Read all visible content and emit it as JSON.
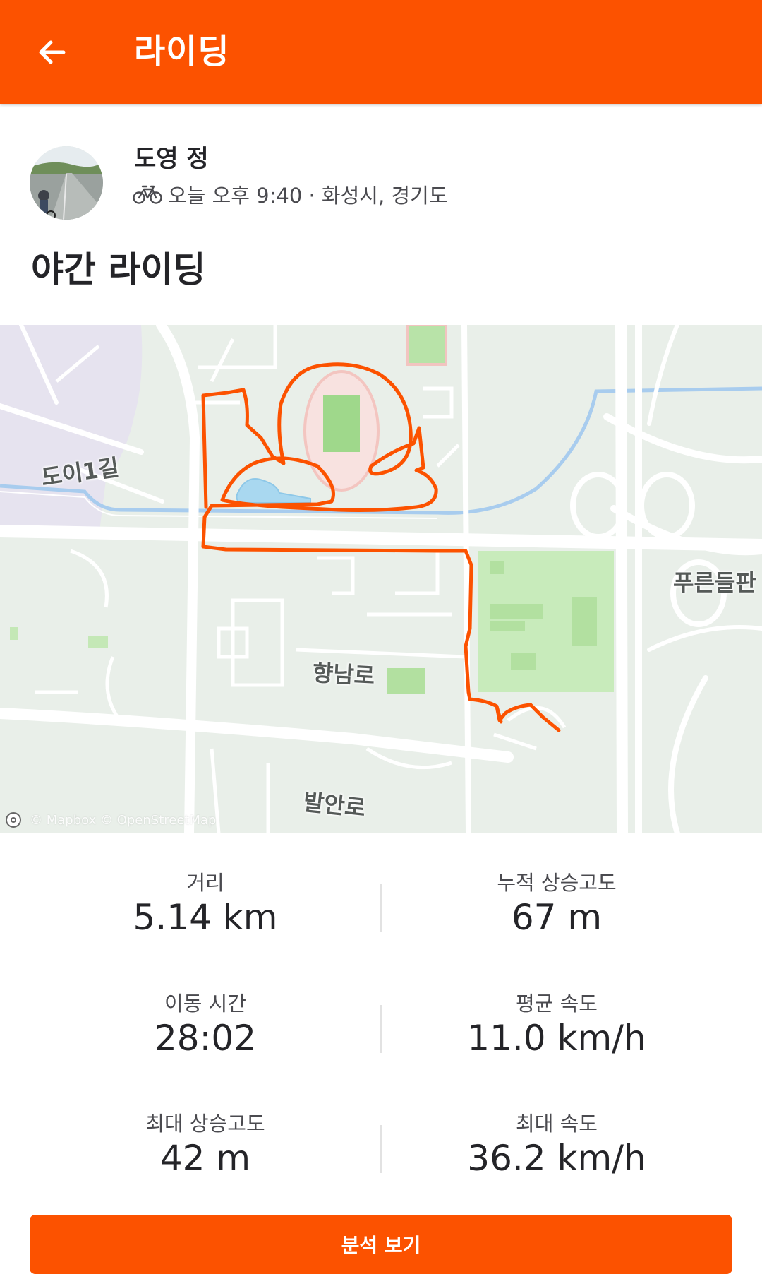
{
  "app_bar": {
    "title": "라이딩",
    "back_icon": "arrow-left-icon"
  },
  "athlete": {
    "name": "도영 정",
    "sport_icon": "bike-icon",
    "meta": "오늘 오후 9:40 · 화성시, 경기도"
  },
  "activity": {
    "title": "야간 라이딩"
  },
  "map": {
    "labels": {
      "street_1": "도이1길",
      "street_2": "푸른들판",
      "street_3": "향남로",
      "street_4": "발안로"
    },
    "attribution": "© Mapbox © OpenStreetMap",
    "route_color": "#fc5200"
  },
  "stats": [
    {
      "label": "거리",
      "value": "5.14 km"
    },
    {
      "label": "누적 상승고도",
      "value": "67 m"
    },
    {
      "label": "이동 시간",
      "value": "28:02"
    },
    {
      "label": "평균 속도",
      "value": "11.0 km/h"
    },
    {
      "label": "최대 상승고도",
      "value": "42 m"
    },
    {
      "label": "최대 속도",
      "value": "36.2 km/h"
    }
  ],
  "cta": {
    "label": "분석 보기"
  },
  "colors": {
    "brand": "#fc5200"
  }
}
